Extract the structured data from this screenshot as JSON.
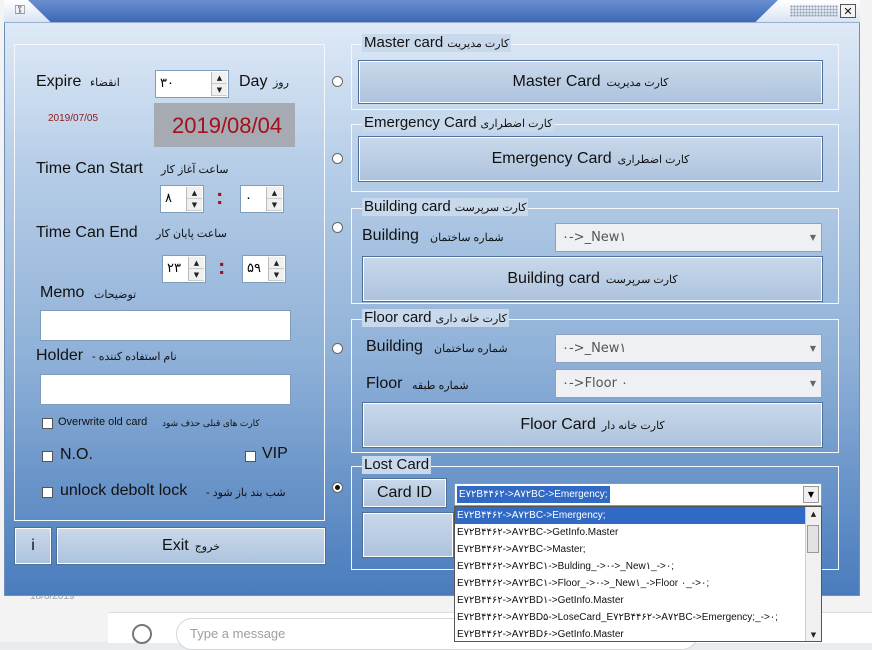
{
  "background": {
    "date": "18/6/2019",
    "message_placeholder": "Type a message"
  },
  "titlebar": {
    "close": "✕"
  },
  "left": {
    "expire_en": "Expire",
    "expire_fa": "انقضاء",
    "expire_value": "۳۰",
    "day_en": "Day",
    "day_fa": "روز",
    "current_date": "2019/07/05",
    "expire_date": "2019/08/04",
    "start_en": "Time Can Start",
    "start_fa": "ساعت آغاز کار",
    "start_hour": "۸",
    "start_min": "۰",
    "end_en": "Time Can End",
    "end_fa": "ساعت پایان کار",
    "end_hour": "۲۳",
    "end_min": "۵۹",
    "colon": ":",
    "memo_en": "Memo",
    "memo_fa": "توضیحات",
    "holder_en": "Holder",
    "holder_fa": "- نام استفاده کننده",
    "overwrite_en": "Overwrite old card",
    "overwrite_fa": "کارت های قبلی حذف شود",
    "no_label": "N.O.",
    "vip_label": "VIP",
    "unlock_en": "unlock debolt lock",
    "unlock_fa": "- شب بند باز شود"
  },
  "buttons": {
    "info": "i",
    "exit_en": "Exit",
    "exit_fa": "خروج"
  },
  "master": {
    "group_en": "Master card",
    "group_fa": "کارت مدیریت",
    "btn_en": "Master Card",
    "btn_fa": "کارت مدیریت"
  },
  "emergency": {
    "group_en": "Emergency Card",
    "group_fa": "کارت اضطراری",
    "btn_en": "Emergency Card",
    "btn_fa": "کارت اضطراری"
  },
  "building": {
    "group_en": "Building card",
    "group_fa": "کارت سرپرست",
    "field_en": "Building",
    "field_fa": "شماره ساختمان",
    "value": "۰->_New۱",
    "btn_en": "Building card",
    "btn_fa": "کارت سرپرست"
  },
  "floor": {
    "group_en": "Floor card",
    "group_fa": "کارت خانه داری",
    "building_en": "Building",
    "building_fa": "شماره ساختمان",
    "building_value": "۰->_New۱",
    "floor_en": "Floor",
    "floor_fa": "شماره طبقه",
    "floor_value": "۰->Floor ۰",
    "btn_en": "Floor Card",
    "btn_fa": "کارت خانه دار"
  },
  "lost": {
    "group_en": "Lost Card",
    "card_id_btn": "Card ID",
    "selected": "E۷۲B۴۴۶۲->A۷۲BC->Emergency;",
    "options": [
      "E۷۲B۴۴۶۲->A۷۲BC->Emergency;",
      "E۷۲B۴۴۶۲->A۷۲BC->GetInfo.Master",
      "E۷۲B۴۴۶۲->A۷۲BC->Master;",
      "E۷۲B۴۴۶۲->A۷۲BC۱->Bulding_->۰->_New۱_->۰;",
      "E۷۲B۴۴۶۲->A۷۲BC۱->Floor_->۰->_New۱_->Floor ۰_->۰;",
      "E۷۲B۴۴۶۲->A۷۲BD۱->GetInfo.Master",
      "E۷۲B۴۴۶۲->A۷۲BD۵->LoseCard_E۷۲B۴۴۶۲->A۷۲BC->Emergency;_->۰;",
      "E۷۲B۴۴۶۲->A۷۲BD۶->GetInfo.Master"
    ]
  }
}
